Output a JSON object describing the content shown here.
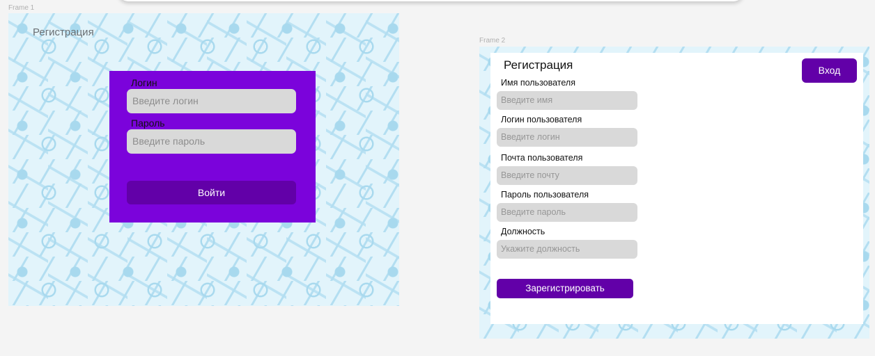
{
  "frames": [
    {
      "label": "Frame 1"
    },
    {
      "label": "Frame 2"
    }
  ],
  "frame1": {
    "title": "Регистрация",
    "login_form": {
      "login_label": "Логин",
      "login_placeholder": "Введите логин",
      "password_label": "Пароль",
      "password_placeholder": "Введите пароль",
      "submit_label": "Войти"
    }
  },
  "frame2": {
    "title": "Регистрация",
    "login_button": "Вход",
    "fields": [
      {
        "label": "Имя пользователя",
        "placeholder": "Введите имя"
      },
      {
        "label": "Логин пользователя",
        "placeholder": "Введите логин"
      },
      {
        "label": "Почта пользователя",
        "placeholder": "Введите почту"
      },
      {
        "label": "Пароль пользователя",
        "placeholder": "Введите пароль"
      },
      {
        "label": "Должность",
        "placeholder": "Укажите должность"
      }
    ],
    "submit_label": "Зарегистрировать"
  },
  "colors": {
    "accent": "#7b03db",
    "button": "#6200a8",
    "pattern_bg": "#e2f4fb",
    "input_bg": "#d9d9d9"
  }
}
